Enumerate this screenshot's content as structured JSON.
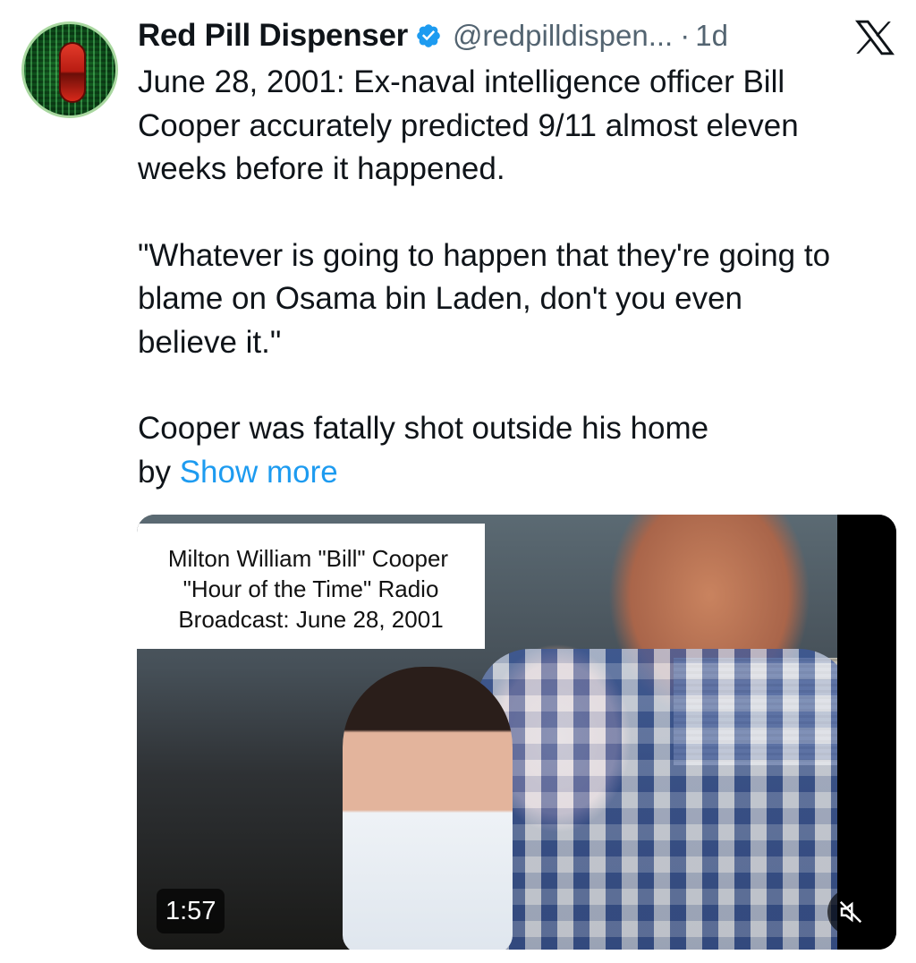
{
  "author": {
    "name": "Red Pill Dispenser",
    "handle": "@redpilldispen...",
    "separator": "·",
    "time": "1d",
    "verified": true,
    "avatar_icon": "red-pill-matrix-icon"
  },
  "platform_logo": "x-logo-icon",
  "tweet": {
    "lines": [
      "June 28, 2001: Ex-naval intelligence officer Bill",
      "Cooper accurately predicted 9/11 almost eleven",
      "weeks before it happened.",
      "\"Whatever is going to happen that they're going to",
      "blame on Osama bin Laden, don't you even",
      "believe it.\"",
      "Cooper was fatally shot outside his home"
    ],
    "truncated_prefix": "by",
    "show_more_label": "Show more"
  },
  "media": {
    "caption_lines": [
      "Milton William \"Bill\" Cooper",
      "\"Hour of the Time\" Radio",
      "Broadcast: June 28, 2001"
    ],
    "duration": "1:57",
    "mute_icon": "muted-speaker-icon"
  },
  "colors": {
    "text": "#0f1419",
    "secondary": "#536471",
    "link": "#1d9bf0",
    "verified": "#1d9bf0"
  }
}
